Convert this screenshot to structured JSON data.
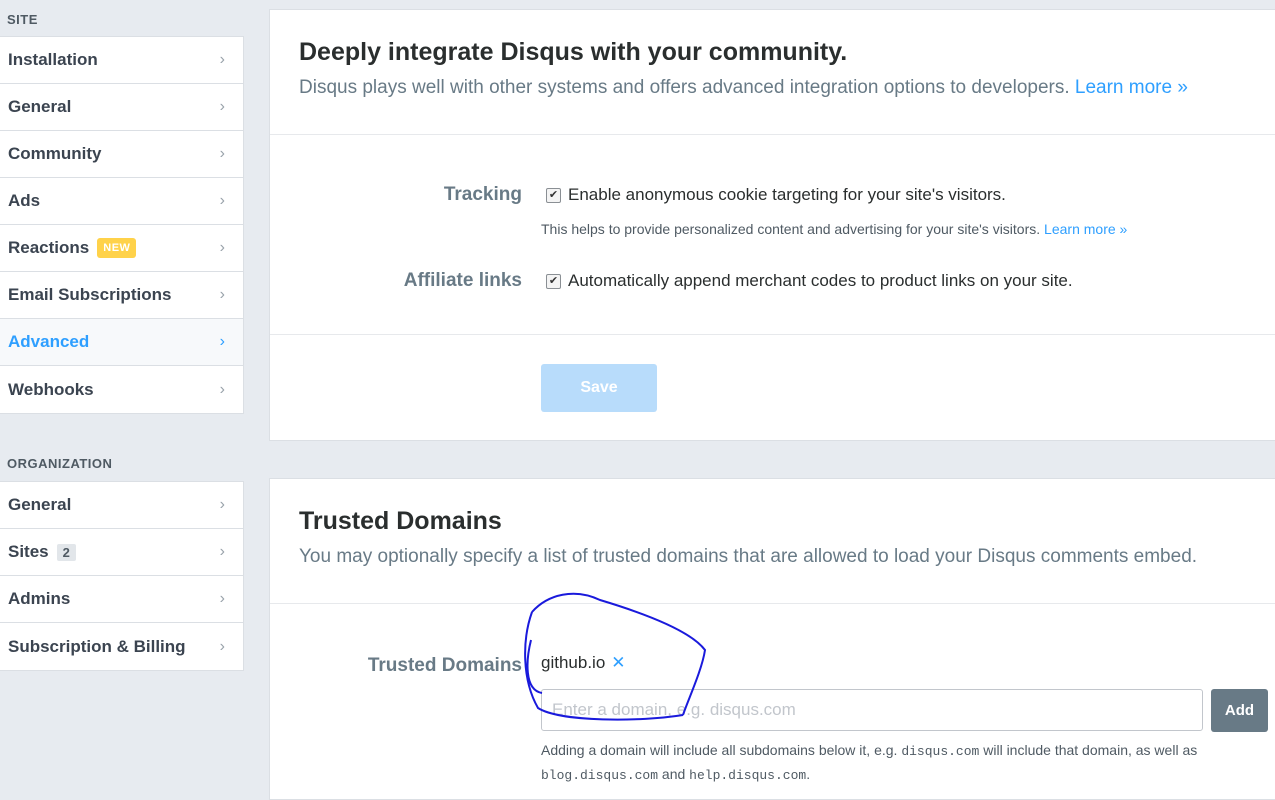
{
  "sidebar": {
    "site_label": "SITE",
    "site_items": [
      {
        "label": "Installation"
      },
      {
        "label": "General"
      },
      {
        "label": "Community"
      },
      {
        "label": "Ads"
      },
      {
        "label": "Reactions",
        "badge": "NEW"
      },
      {
        "label": "Email Subscriptions"
      },
      {
        "label": "Advanced",
        "active": true
      },
      {
        "label": "Webhooks"
      }
    ],
    "org_label": "ORGANIZATION",
    "org_items": [
      {
        "label": "General"
      },
      {
        "label": "Sites",
        "count": "2"
      },
      {
        "label": "Admins"
      },
      {
        "label": "Subscription & Billing"
      }
    ],
    "chevron": "›"
  },
  "advanced": {
    "title": "Deeply integrate Disqus with your community.",
    "subtitle": "Disqus plays well with other systems and offers advanced integration options to developers.",
    "learn_more": "Learn more »",
    "tracking": {
      "label": "Tracking",
      "checked": true,
      "text": "Enable anonymous cookie targeting for your site's visitors.",
      "help": "This helps to provide personalized content and advertising for your site's visitors.",
      "help_link": "Learn more »"
    },
    "affiliate": {
      "label": "Affiliate links",
      "checked": true,
      "text": "Automatically append merchant codes to product links on your site."
    },
    "save_label": "Save",
    "check_glyph": "✔"
  },
  "trusted": {
    "title": "Trusted Domains",
    "subtitle": "You may optionally specify a list of trusted domains that are allowed to load your Disqus comments embed.",
    "field_label": "Trusted Domains",
    "domain": "github.io",
    "remove_glyph": "✕",
    "input_placeholder": "Enter a domain, e.g. disqus.com",
    "input_value": "",
    "add_label": "Add",
    "help_parts": {
      "p1": "Adding a domain will include all subdomains below it, e.g.",
      "code1": "disqus.com",
      "p2": "will include that domain, as well as",
      "code2": "blog.disqus.com",
      "p3": "and",
      "code3": "help.disqus.com",
      "p4": "."
    }
  },
  "colors": {
    "accent": "#2e9fff",
    "annotation": "#1a1adc",
    "badge_new": "#ffd24a"
  }
}
